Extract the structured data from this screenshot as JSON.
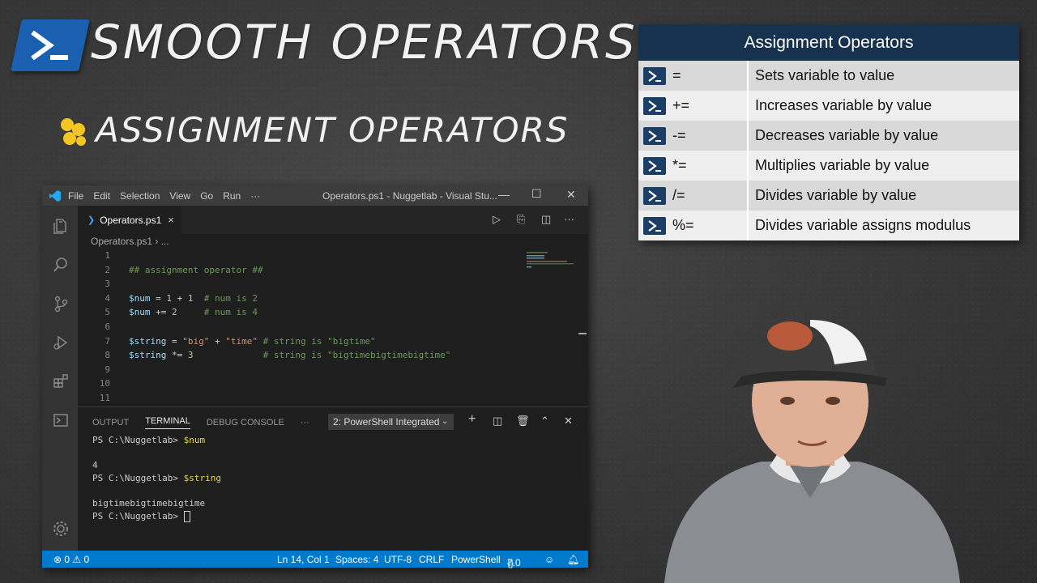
{
  "slide": {
    "title": "SMOOTH OPERATORS",
    "subtitle": "ASSIGNMENT OPERATORS"
  },
  "operators_table": {
    "header": "Assignment Operators",
    "rows": [
      {
        "op": "=",
        "desc": "Sets variable to value"
      },
      {
        "op": "+=",
        "desc": "Increases variable by value"
      },
      {
        "op": "-=",
        "desc": "Decreases variable by value"
      },
      {
        "op": "*=",
        "desc": "Multiplies variable by value"
      },
      {
        "op": "/=",
        "desc": "Divides variable by value"
      },
      {
        "op": "%=",
        "desc": "Divides variable assigns modulus"
      }
    ]
  },
  "vscode": {
    "menu": [
      "File",
      "Edit",
      "Selection",
      "View",
      "Go",
      "Run",
      "···"
    ],
    "window_title": "Operators.ps1 - Nuggetlab - Visual Stu...",
    "tab": {
      "label": "Operators.ps1",
      "close": "×"
    },
    "breadcrumb": "Operators.ps1 › ...",
    "lines": [
      "1",
      "2",
      "3",
      "4",
      "5",
      "6",
      "7",
      "8",
      "9",
      "10",
      "11"
    ],
    "code": {
      "l2": "## assignment operator ##",
      "l4_var": "$num",
      "l4_mid": " = ",
      "l4_n1": "1",
      "l4_plus": " + ",
      "l4_n2": "1",
      "l4_cmt": "  # num is 2",
      "l5_var": "$num",
      "l5_mid": " += ",
      "l5_n": "2",
      "l5_cmt": "     # num is 4",
      "l7_var": "$string",
      "l7_mid": " = ",
      "l7_s1": "\"big\"",
      "l7_plus": " + ",
      "l7_s2": "\"time\"",
      "l7_cmt": " # string is \"bigtime\"",
      "l8_var": "$string",
      "l8_mid": " *= ",
      "l8_n": "3",
      "l8_cmt": "             # string is \"bigtimebigtimebigtime\""
    },
    "panel": {
      "tabs": {
        "output": "OUTPUT",
        "terminal": "TERMINAL",
        "debug": "DEBUG CONSOLE",
        "more": "···"
      },
      "shell": "2: PowerShell Integrated",
      "terminal": {
        "p1_prompt": "PS C:\\Nuggetlab> ",
        "p1_cmd": "$num",
        "out1": "4",
        "p2_prompt": "PS C:\\Nuggetlab> ",
        "p2_cmd": "$string",
        "out2": "bigtimebigtimebigtime",
        "p3_prompt": "PS C:\\Nuggetlab> "
      }
    },
    "status": {
      "errors": "⊗ 0 ⚠ 0",
      "position": "Ln 14, Col 1",
      "spaces": "Spaces: 4",
      "encoding": "UTF-8",
      "eol": "CRLF",
      "language": "PowerShell",
      "version": "7.0"
    }
  },
  "colors": {
    "accent": "#007acc",
    "table_header": "#17324f",
    "ps_blue": "#1b5fb0"
  }
}
